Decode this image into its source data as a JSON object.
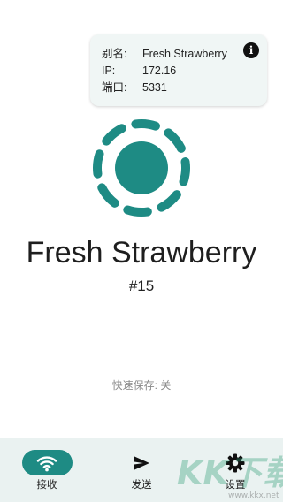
{
  "info_card": {
    "alias_label": "别名:",
    "alias_value": "Fresh Strawberry",
    "ip_label": "IP:",
    "ip_value": "172.16",
    "port_label": "端口:",
    "port_value": "5331",
    "info_icon": "info-icon"
  },
  "device": {
    "name": "Fresh Strawberry",
    "number": "#15"
  },
  "quick_save": "快速保存: 关",
  "bottom_nav": {
    "items": [
      {
        "label": "接收",
        "icon": "wifi-icon",
        "active": true
      },
      {
        "label": "发送",
        "icon": "send-icon",
        "active": false
      },
      {
        "label": "设置",
        "icon": "gear-icon",
        "active": false
      }
    ]
  },
  "colors": {
    "accent": "#1e8b84",
    "card_bg": "#f0f6f5",
    "nav_bg": "#eaf2f1"
  },
  "watermark": {
    "text": "KK下载",
    "url": "www.kkx.net"
  }
}
